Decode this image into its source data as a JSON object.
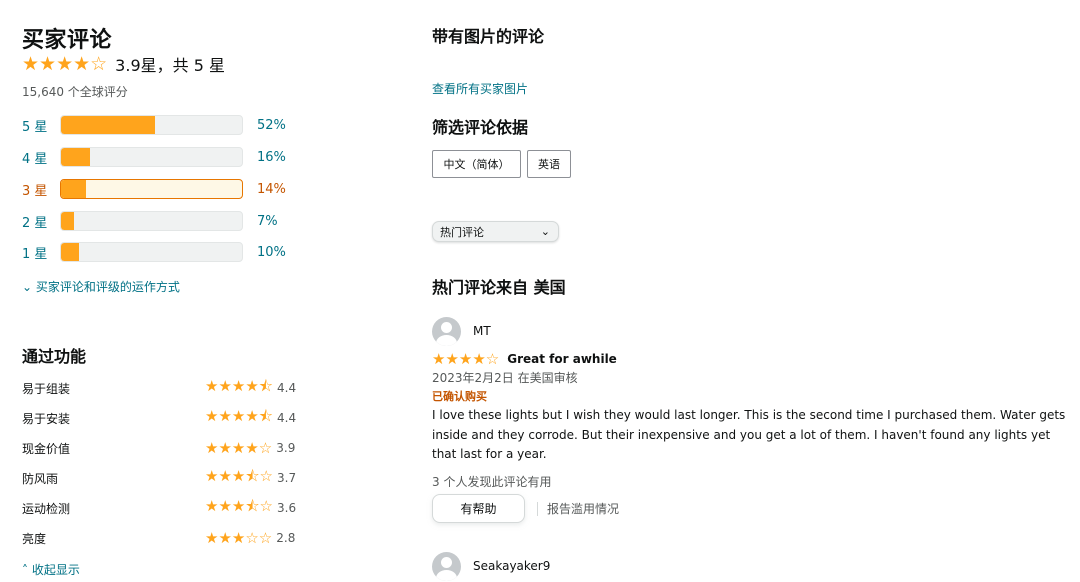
{
  "summary": {
    "title": "买家评论",
    "stars": "★★★★☆",
    "average_text": "3.9星，共 5 星",
    "global_count": "15,640 个全球评分"
  },
  "histogram": [
    {
      "label": "5 星",
      "percent_text": "52%",
      "percent": 52,
      "active": false
    },
    {
      "label": "4 星",
      "percent_text": "16%",
      "percent": 16,
      "active": false
    },
    {
      "label": "3 星",
      "percent_text": "14%",
      "percent": 14,
      "active": true
    },
    {
      "label": "2 星",
      "percent_text": "7%",
      "percent": 7,
      "active": false
    },
    {
      "label": "1 星",
      "percent_text": "10%",
      "percent": 10,
      "active": false
    }
  ],
  "how_link": "⌄ 买家评论和评级的运作方式",
  "features": {
    "title": "通过功能",
    "items": [
      {
        "name": "易于组装",
        "stars": "★★★★⯪",
        "value": "4.4"
      },
      {
        "name": "易于安装",
        "stars": "★★★★⯪",
        "value": "4.4"
      },
      {
        "name": "现金价值",
        "stars": "★★★★☆",
        "value": "3.9"
      },
      {
        "name": "防风雨",
        "stars": "★★★⯪☆",
        "value": "3.7"
      },
      {
        "name": "运动检测",
        "stars": "★★★⯪☆",
        "value": "3.6"
      },
      {
        "name": "亮度",
        "stars": "★★★☆☆",
        "value": "2.8"
      }
    ],
    "collapse_link": "˄ 收起显示"
  },
  "images_section": {
    "title": "带有图片的评论",
    "see_all_link": "查看所有买家图片"
  },
  "filter": {
    "title": "筛选评论依据",
    "lang_buttons": [
      "中文（简体）",
      "英语"
    ],
    "sort_value": "热门评论",
    "sort_chevron": "⌄"
  },
  "top_reviews": {
    "title": "热门评论来自 美国",
    "reviews": [
      {
        "author": "MT",
        "stars": "★★★★☆",
        "title": "Great for awhile",
        "date": "2023年2月2日 在美国审核",
        "verified": "已确认购买",
        "body": "I love these lights but I wish they would last longer. This is the second time I purchased them. Water gets inside and they corrode. But their inexpensive and you get a lot of them. I haven't found any lights yet that last for a year.",
        "helpful_count": "3 个人发现此评论有用",
        "helpful_button": "有帮助",
        "report_link": "报告滥用情况"
      },
      {
        "author": "Seakayaker9"
      }
    ]
  },
  "colors": {
    "star": "#ffa41c",
    "link": "#007185",
    "active": "#c45500",
    "muted": "#565959"
  }
}
